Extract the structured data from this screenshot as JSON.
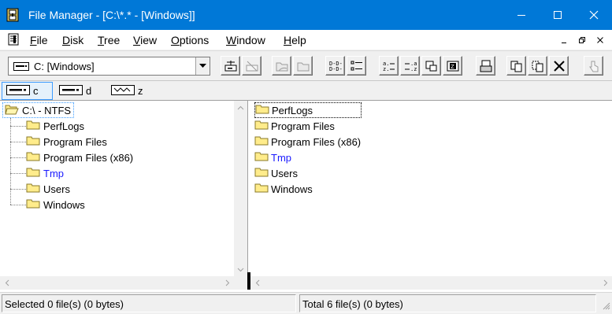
{
  "window": {
    "title": "File Manager - [C:\\*.* - [Windows]]",
    "controls": {
      "minimize": "minimize",
      "maximize": "maximize",
      "close": "close"
    }
  },
  "menubar": {
    "items": [
      {
        "mnemonic": "F",
        "rest": "ile"
      },
      {
        "mnemonic": "D",
        "rest": "isk"
      },
      {
        "mnemonic": "T",
        "rest": "ree"
      },
      {
        "mnemonic": "V",
        "rest": "iew"
      },
      {
        "mnemonic": "O",
        "rest": "ptions"
      },
      {
        "mnemonic": "W",
        "rest": "indow"
      },
      {
        "mnemonic": "H",
        "rest": "elp"
      }
    ]
  },
  "toolbar": {
    "drive_select": "C: [Windows]"
  },
  "drives": [
    {
      "label": "c",
      "icon": "hard-drive-icon",
      "active": true
    },
    {
      "label": "d",
      "icon": "hard-drive-icon",
      "active": false
    },
    {
      "label": "z",
      "icon": "network-drive-icon",
      "active": false
    }
  ],
  "tree": {
    "root": "C:\\ - NTFS",
    "items": [
      {
        "name": "PerfLogs",
        "color": "#000000"
      },
      {
        "name": "Program Files",
        "color": "#000000"
      },
      {
        "name": "Program Files (x86)",
        "color": "#000000"
      },
      {
        "name": "Tmp",
        "color": "#1a1aff"
      },
      {
        "name": "Users",
        "color": "#000000"
      },
      {
        "name": "Windows",
        "color": "#000000"
      }
    ]
  },
  "directory": {
    "items": [
      {
        "name": "PerfLogs"
      },
      {
        "name": "Program Files"
      },
      {
        "name": "Program Files (x86)"
      },
      {
        "name": "Tmp"
      },
      {
        "name": "Users"
      },
      {
        "name": "Windows"
      }
    ]
  },
  "status": {
    "left": "Selected 0 file(s) (0 bytes)",
    "right": "Total 6 file(s) (0 bytes)"
  },
  "colors": {
    "titlebar": "#0078d7",
    "folder": "#ffec8b",
    "compressed_blue": "#1a1aff"
  }
}
